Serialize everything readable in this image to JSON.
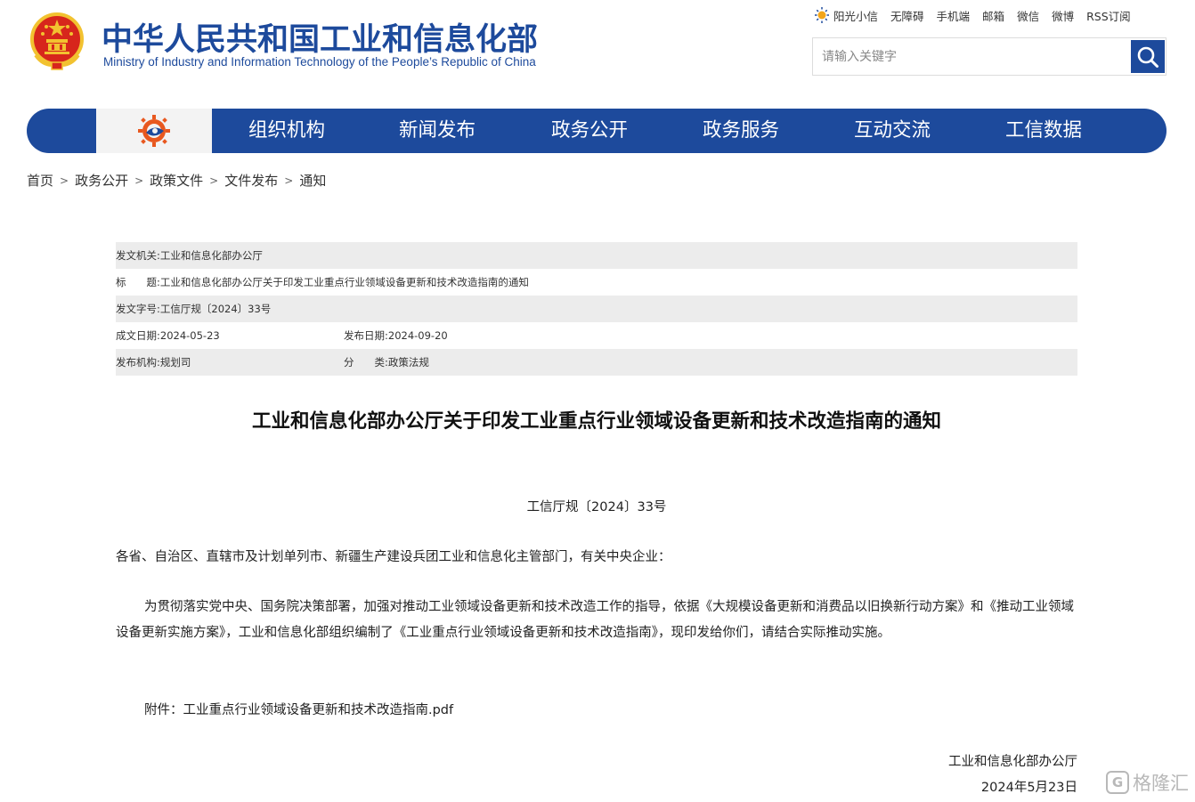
{
  "header": {
    "title_cn": "中华人民共和国工业和信息化部",
    "title_en": "Ministry of Industry and Information Technology of the People’s Republic of China",
    "top_links": [
      "阳光小信",
      "无障碍",
      "手机端",
      "邮箱",
      "微信",
      "微博",
      "RSS订阅"
    ],
    "search": {
      "placeholder": "请输入关键字",
      "value": ""
    },
    "colors": {
      "brand_blue": "#1d4a9c",
      "emblem_red": "#d7261c",
      "emblem_gold": "#f2c230"
    }
  },
  "nav": {
    "items": [
      "组织机构",
      "新闻发布",
      "政务公开",
      "政务服务",
      "互动交流",
      "工信数据"
    ]
  },
  "breadcrumb": [
    "首页",
    "政务公开",
    "政策文件",
    "文件发布",
    "通知"
  ],
  "breadcrumb_separator": ">",
  "meta": {
    "issuer_label": "发文机关:",
    "issuer": "工业和信息化部办公厅",
    "title_label": "标　　题:",
    "title": "工业和信息化部办公厅关于印发工业重点行业领域设备更新和技术改造指南的通知",
    "doc_no_label": "发文字号:",
    "doc_no": "工信厅规〔2024〕33号",
    "written_date_label": "成文日期:",
    "written_date": "2024-05-23",
    "publish_date_label": "发布日期:",
    "publish_date": "2024-09-20",
    "publisher_label": "发布机构:",
    "publisher": "规划司",
    "category_label": "分　　类:",
    "category": "政策法规"
  },
  "article": {
    "title": "工业和信息化部办公厅关于印发工业重点行业领域设备更新和技术改造指南的通知",
    "doc_number": "工信厅规〔2024〕33号",
    "addressee": "各省、自治区、直辖市及计划单列市、新疆生产建设兵团工业和信息化主管部门，有关中央企业：",
    "body": "为贯彻落实党中央、国务院决策部署，加强对推动工业领域设备更新和技术改造工作的指导，依据《大规模设备更新和消费品以旧换新行动方案》和《推动工业领域设备更新实施方案》，工业和信息化部组织编制了《工业重点行业领域设备更新和技术改造指南》，现印发给你们，请结合实际推动实施。",
    "attachment_label": "附件：",
    "attachment_file": "工业重点行业领域设备更新和技术改造指南.pdf",
    "signature_org": "工业和信息化部办公厅",
    "signature_date": "2024年5月23日"
  },
  "watermark": {
    "text": "格隆汇"
  }
}
